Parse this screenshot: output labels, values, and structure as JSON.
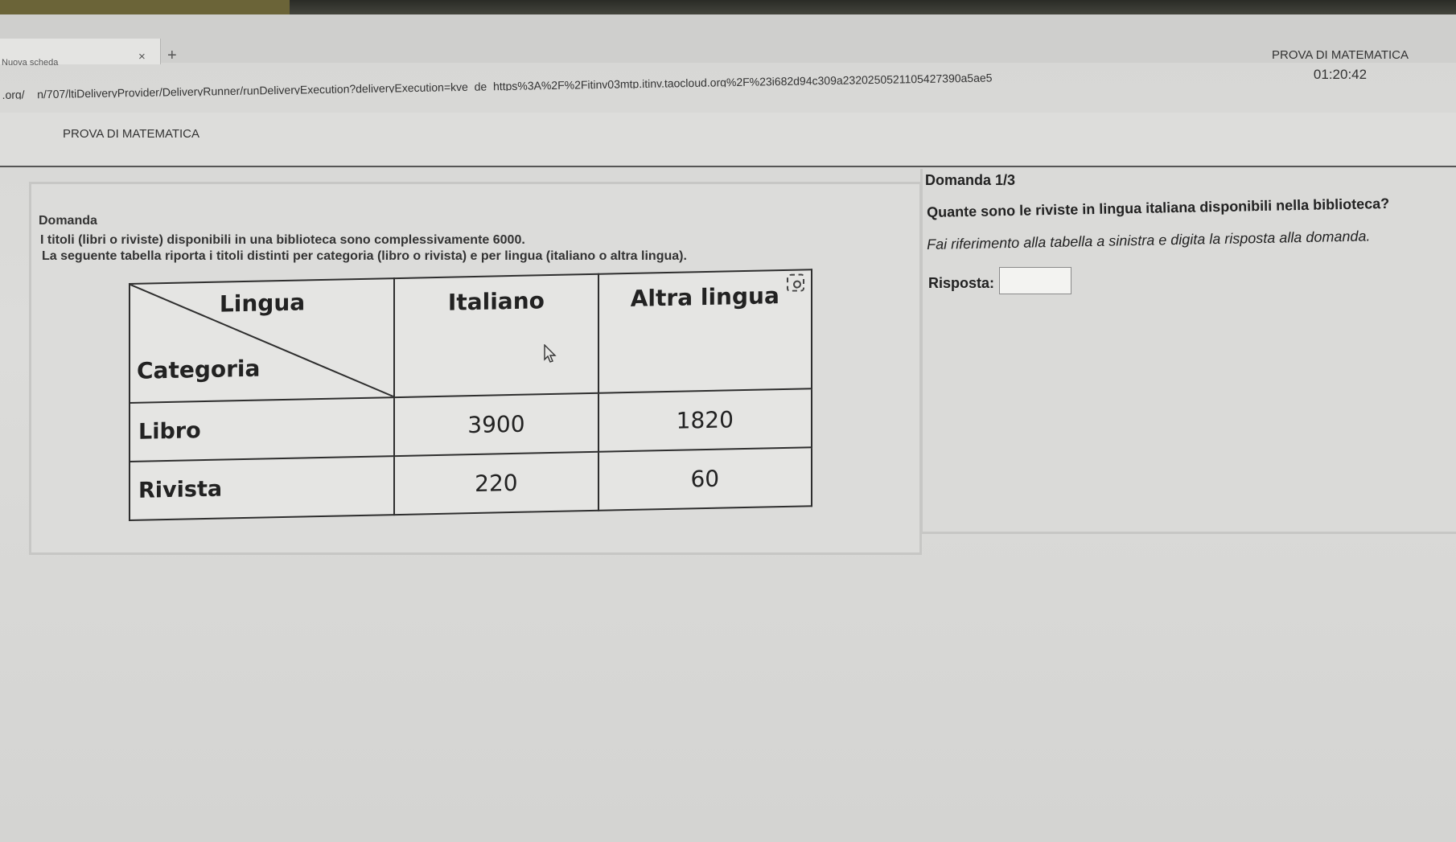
{
  "browser": {
    "tab_title": "Nuova scheda",
    "tab_close": "×",
    "new_tab": "+",
    "url": ".org/__n/707/ltiDeliveryProvider/DeliveryRunner/runDeliveryExecution?deliveryExecution=kve_de_https%3A%2F%2Fitinv03mtp.itinv.taocloud.org%2F%23i682d94c309a2320250521105427390a5ae5"
  },
  "header": {
    "exam_title": "PROVA DI MATEMATICA",
    "timer": "01:20:42"
  },
  "page": {
    "title": "PROVA DI MATEMATICA"
  },
  "stimulus": {
    "label": "Domanda",
    "line1": "I titoli (libri o riviste) disponibili in una biblioteca sono complessivamente 6000.",
    "line2": "La seguente tabella riporta i titoli distinti per categoria (libro o rivista) e per lingua (italiano o altra lingua).",
    "table": {
      "corner_top": "Lingua",
      "corner_bottom": "Categoria",
      "col_headers": [
        "Italiano",
        "Altra lingua"
      ],
      "rows": [
        {
          "label": "Libro",
          "values": [
            "3900",
            "1820"
          ]
        },
        {
          "label": "Rivista",
          "values": [
            "220",
            "60"
          ]
        }
      ]
    }
  },
  "question": {
    "counter": "Domanda 1/3",
    "text": "Quante sono le riviste in lingua italiana disponibili nella biblioteca?",
    "instruction": "Fai riferimento alla tabella a sinistra e digita la risposta alla domanda.",
    "answer_label": "Risposta:",
    "answer_value": ""
  },
  "icons": {
    "focus": "focus-frame-icon",
    "cursor": "mouse-pointer-icon"
  }
}
